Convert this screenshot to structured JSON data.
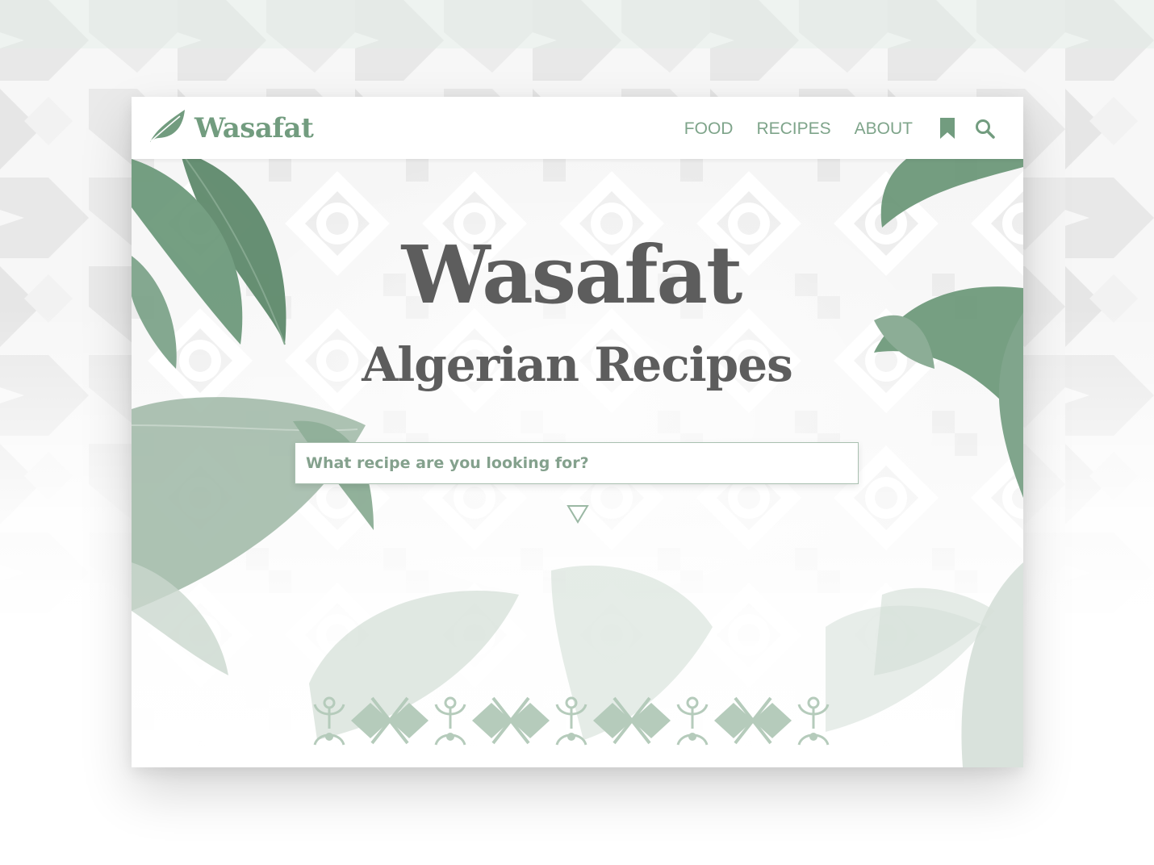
{
  "brand": {
    "name": "Wasafat",
    "accent_color": "#729c7f"
  },
  "nav": {
    "items": [
      {
        "label": "FOOD"
      },
      {
        "label": "RECIPES"
      },
      {
        "label": "ABOUT"
      }
    ],
    "icons": [
      "bookmark-icon",
      "search-icon"
    ]
  },
  "hero": {
    "title": "Wasafat",
    "subtitle": "Algerian Recipes",
    "text_color": "#5d5d5d"
  },
  "search": {
    "placeholder": "What recipe are you looking for?",
    "value": ""
  },
  "scroll_indicator": "triangle-down-icon",
  "colors": {
    "leaf_dark": "#5f8c6e",
    "leaf_light": "#c9d8cd",
    "ornament": "#b5cbbb",
    "pattern": "#e9e9e9"
  }
}
